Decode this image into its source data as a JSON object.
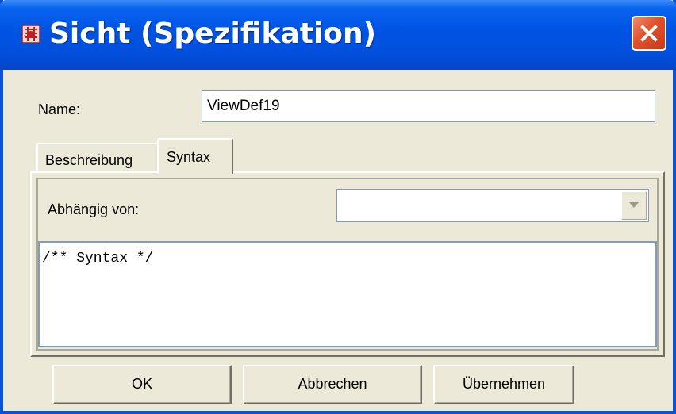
{
  "window": {
    "title": "Sicht (Spezifikation)",
    "icon": "app-icon",
    "close_icon": "close-icon"
  },
  "form": {
    "name_label": "Name:",
    "name_value": "ViewDef19"
  },
  "tabs": [
    {
      "label": "Beschreibung",
      "selected": false
    },
    {
      "label": "Syntax",
      "selected": true
    }
  ],
  "syntax_tab": {
    "depends_label": "Abhängig von:",
    "depends_value": "",
    "syntax_text": "/** Syntax */"
  },
  "buttons": {
    "ok": "OK",
    "cancel": "Abbrechen",
    "apply": "Übernehmen"
  },
  "colors": {
    "titlebar": "#0054e3",
    "dialog_bg": "#ece9d8",
    "close_button": "#e0502a"
  }
}
